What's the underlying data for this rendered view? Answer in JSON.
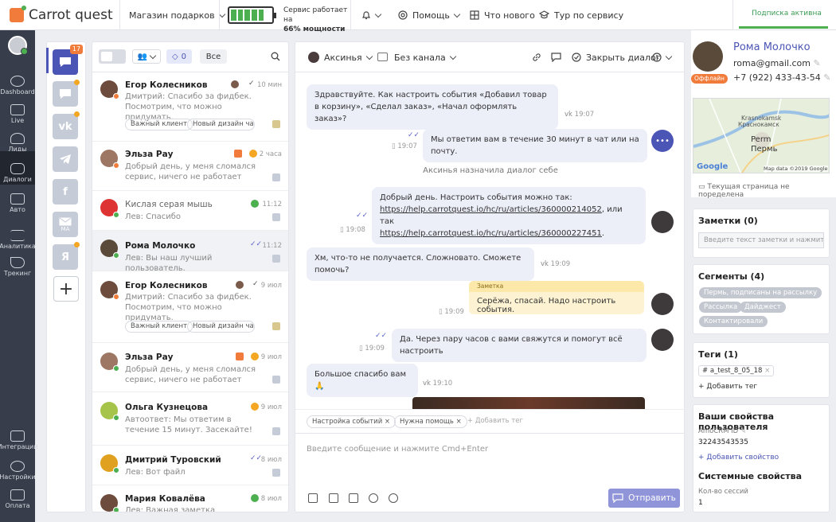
{
  "topbar": {
    "logo": "Carrot quest",
    "shop": "Магазин подарков",
    "power_line1": "Сервис работает на",
    "power_line2": "66% мощности",
    "help": "Помощь",
    "whats_new": "Что нового",
    "tour": "Тур по сервису",
    "subscription": "Подписка активна",
    "battery_level": 0.66
  },
  "leftnav": {
    "items": [
      {
        "label": "Dashboard"
      },
      {
        "label": "Live"
      },
      {
        "label": "Лиды"
      },
      {
        "label": "Диалоги"
      },
      {
        "label": "Авто"
      },
      {
        "label": "Аналитика"
      },
      {
        "label": "Трекинг"
      },
      {
        "label": "Интеграции"
      },
      {
        "label": "Настройки"
      },
      {
        "label": "Оплата"
      }
    ]
  },
  "channels": {
    "badge": "17",
    "mail_label": "MA",
    "yandex_label": "Я"
  },
  "convtools": {
    "tag_count": "0",
    "all_label": "Все"
  },
  "conversations": [
    {
      "name": "Егор Колесников",
      "time": "10 мин",
      "preview": "Дмитрий: Спасибо за фидбек. Посмотрим, что можно придумать.",
      "tags": [
        "Важный клиент",
        "Новый дизайн чата"
      ]
    },
    {
      "name": "Эльза Рау",
      "time": "2 часа",
      "preview": "Добрый день, у меня сломался сервис, ничего не работает"
    },
    {
      "name": "Кислая серая мышь",
      "time": "11:12",
      "preview": "Лев: Спасибо"
    },
    {
      "name": "Рома Молочко",
      "time": "11:12",
      "preview": "Лев: Вы наш лучший пользователь."
    },
    {
      "name": "Егор Колесников",
      "time": "9 июл",
      "preview": "Дмитрий: Спасибо за фидбек. Посмотрим, что можно придумать.",
      "tags": [
        "Важный клиент",
        "Новый дизайн чата"
      ]
    },
    {
      "name": "Эльза Рау",
      "time": "9 июл",
      "preview": "Добрый день, у меня сломался сервис, ничего не работает"
    },
    {
      "name": "Ольга Кузнецова",
      "time": "9 июл",
      "preview": "Автоответ: Мы ответим в течение 15 минут. Засекайте!"
    },
    {
      "name": "Дмитрий Туровский",
      "time": "8 июл",
      "preview": "Лев: Вот файл"
    },
    {
      "name": "Мария Ковалёва",
      "time": "8 июл",
      "preview": "Лев: Важная заметка"
    }
  ],
  "chat": {
    "assignee": "Аксинья",
    "channel": "Без канала",
    "close": "Закрыть диалог",
    "messages": {
      "m1": "Здравствуйте. Как настроить события «Добавил товар в корзину», «Сделал заказ», «Начал оформлять заказ»?",
      "m1_time": "19:07",
      "m2": "Мы ответим вам в течение 30 минут в чат или на почту.",
      "m2_time": "19:07",
      "sys": "Аксинья назначила диалог себе",
      "m3_a": "Добрый день. Настроить события можно так:",
      "m3_link1": "https://help.carrotquest.io/hc/ru/articles/360000214052",
      "m3_mid": ", или так",
      "m3_link2": "https://help.carrotquest.io/hc/ru/articles/360000227451",
      "m3_end": ".",
      "m3_time": "19:08",
      "m4": "Хм, что-то не получается. Сложновато. Сможете помочь?",
      "m4_time": "19:09",
      "note_head": "Заметка",
      "note": "Серёжа, спасай. Надо настроить события.",
      "note_time": "19:09",
      "m5": "Да. Через пару часов с вами свяжутся и помогут всё настроить",
      "m5_time": "19:09",
      "m6": "Большое спасибо вам 🙏",
      "m6_time": "19:10"
    },
    "tags": [
      "Настройка событий",
      "Нужна помощь"
    ],
    "add_tag": "Добавить тег",
    "placeholder": "Введите сообщение и нажмите Cmd+Enter",
    "send": "Отправить"
  },
  "profile": {
    "name": "Рома Молочко",
    "email": "roma@gmail.com",
    "phone": "+7 (922) 433-43-54",
    "status": "Оффлайн",
    "map_labels": {
      "krasnokamsk": "Krasnokamsk",
      "krasnokamsk_ru": "Краснокамск",
      "perm": "Perm",
      "perm_ru": "Пермь",
      "google": "Google",
      "attribution": "Map data ©2019 Google"
    },
    "current_page": "Текущая страница не поределена"
  },
  "notes": {
    "title": "Заметки (0)",
    "placeholder": "Введите текст заметки и нажмите..."
  },
  "segments": {
    "title": "Сегменты (4)",
    "items": [
      "Пермь, подписаны на рассылку",
      "Рассылка",
      "Дайджест",
      "Контактировали"
    ]
  },
  "tags_panel": {
    "title": "Теги (1)",
    "tag": "# a_test_8_05_18",
    "add": "Добавить тег"
  },
  "props": {
    "title": "Ваши свойства пользователя",
    "amo_label": "AmoCRM ID",
    "amo_value": "32243543535",
    "add_prop": "Добавить свойство",
    "system_title": "Системные свойства",
    "sessions_label": "Кол-во сессий",
    "sessions_value": "1"
  },
  "colors": {
    "accent": "#4b55b5",
    "green": "#4caf50",
    "orange": "#f07b3a",
    "nav": "#373d4a"
  }
}
